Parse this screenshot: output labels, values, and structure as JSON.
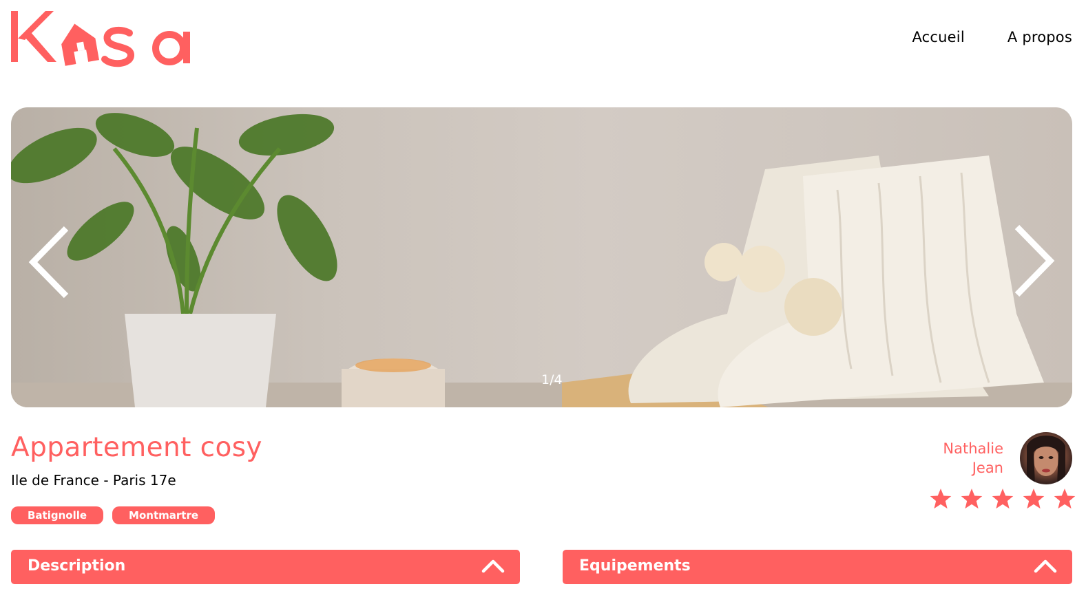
{
  "brand": {
    "logo_text": "Kasa",
    "accent_color": "#FF6060"
  },
  "nav": {
    "home": "Accueil",
    "about": "A propos"
  },
  "carousel": {
    "counter": "1/4",
    "prev_icon": "chevron-left-icon",
    "next_icon": "chevron-right-icon"
  },
  "listing": {
    "title": "Appartement cosy",
    "location": "Ile de France - Paris 17e",
    "tags": [
      "Batignolle",
      "Montmartre"
    ],
    "rating": 5,
    "rating_max": 5
  },
  "host": {
    "first_name": "Nathalie",
    "last_name": "Jean"
  },
  "sections": {
    "description": "Description",
    "equipments": "Equipements"
  }
}
